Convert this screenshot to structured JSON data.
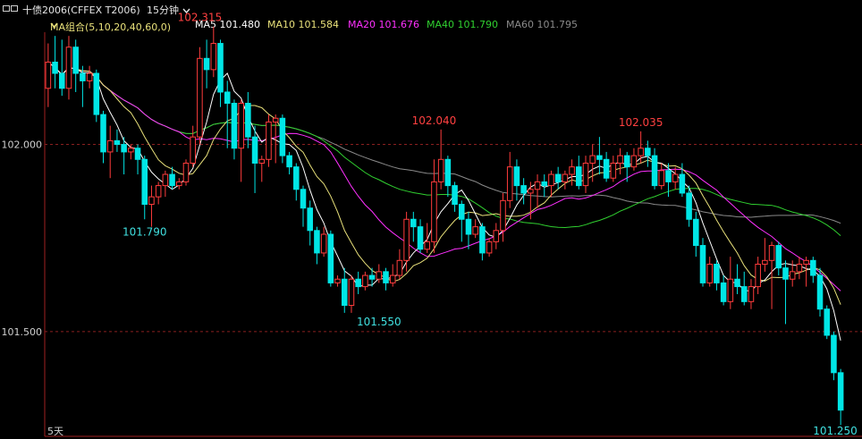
{
  "header": {
    "window_icon": "window-icon",
    "title": "十债2006(CFFEX T2006)",
    "period": "15分钟",
    "period_icon": "chevron-down-icon"
  },
  "indicators": {
    "group_label": "MA组合(5,10,20,40,60,0)",
    "group_icon": "chevron-down-icon",
    "items": [
      {
        "label": "MA5 101.480",
        "color": "#ffffff"
      },
      {
        "label": "MA10 101.584",
        "color": "#e8e07a"
      },
      {
        "label": "MA20 101.676",
        "color": "#ff30ff"
      },
      {
        "label": "MA40 101.790",
        "color": "#30d030"
      },
      {
        "label": "MA60 101.795",
        "color": "#8a8a8a"
      }
    ]
  },
  "footer": {
    "days_label": "5天"
  },
  "chart_data": {
    "type": "candlestick",
    "ylim": [
      101.22,
      102.3
    ],
    "y_ticks": [
      {
        "label": "102.000",
        "value": 102.0
      },
      {
        "label": "101.500",
        "value": 101.5
      }
    ],
    "annotations": [
      {
        "text": "102.315",
        "index": 22,
        "value": 102.315,
        "color": "#ff4040"
      },
      {
        "text": "101.790",
        "index": 14,
        "value": 101.79,
        "color": "#40e0e0"
      },
      {
        "text": "102.040",
        "index": 56,
        "value": 102.04,
        "color": "#ff4040"
      },
      {
        "text": "101.550",
        "index": 48,
        "value": 101.55,
        "color": "#40e0e0"
      },
      {
        "text": "102.035",
        "index": 86,
        "value": 102.035,
        "color": "#ff4040"
      },
      {
        "text": "101.250",
        "index": 115,
        "value": 101.25,
        "color": "#40e0e0"
      }
    ],
    "candles": [
      [
        102.15,
        102.22,
        102.27,
        102.1
      ],
      [
        102.22,
        102.19,
        102.29,
        102.15
      ],
      [
        102.19,
        102.15,
        102.28,
        102.13
      ],
      [
        102.15,
        102.26,
        102.29,
        102.12
      ],
      [
        102.26,
        102.19,
        102.28,
        102.14
      ],
      [
        102.19,
        102.17,
        102.21,
        102.1
      ],
      [
        102.17,
        102.19,
        102.21,
        102.15
      ],
      [
        102.19,
        102.08,
        102.2,
        102.06
      ],
      [
        102.08,
        101.98,
        102.09,
        101.95
      ],
      [
        101.98,
        102.01,
        102.05,
        101.91
      ],
      [
        102.01,
        102.0,
        102.04,
        101.98
      ],
      [
        102.0,
        101.98,
        102.02,
        101.92
      ],
      [
        101.98,
        101.99,
        102.0,
        101.96
      ],
      [
        101.99,
        101.96,
        102.0,
        101.92
      ],
      [
        101.96,
        101.84,
        101.97,
        101.8
      ],
      [
        101.84,
        101.86,
        101.89,
        101.78
      ],
      [
        101.86,
        101.89,
        101.9,
        101.84
      ],
      [
        101.89,
        101.92,
        101.93,
        101.86
      ],
      [
        101.92,
        101.89,
        101.94,
        101.88
      ],
      [
        101.89,
        101.9,
        101.91,
        101.88
      ],
      [
        101.9,
        101.95,
        101.96,
        101.89
      ],
      [
        101.95,
        102.02,
        102.05,
        101.94
      ],
      [
        102.02,
        102.23,
        102.26,
        102.0
      ],
      [
        102.23,
        102.2,
        102.28,
        102.15
      ],
      [
        102.2,
        102.27,
        102.315,
        102.18
      ],
      [
        102.27,
        102.14,
        102.28,
        102.1
      ],
      [
        102.14,
        102.11,
        102.17,
        101.99
      ],
      [
        102.11,
        101.99,
        102.12,
        101.96
      ],
      [
        101.99,
        102.11,
        102.12,
        101.9
      ],
      [
        102.11,
        102.02,
        102.14,
        101.99
      ],
      [
        102.02,
        101.95,
        102.05,
        101.87
      ],
      [
        101.95,
        101.96,
        101.97,
        101.9
      ],
      [
        101.96,
        102.06,
        102.08,
        101.94
      ],
      [
        102.06,
        102.07,
        102.08,
        101.95
      ],
      [
        102.07,
        101.97,
        102.08,
        101.95
      ],
      [
        101.97,
        101.94,
        101.98,
        101.92
      ],
      [
        101.94,
        101.88,
        101.95,
        101.85
      ],
      [
        101.88,
        101.83,
        101.89,
        101.78
      ],
      [
        101.83,
        101.77,
        101.85,
        101.73
      ],
      [
        101.77,
        101.71,
        101.78,
        101.68
      ],
      [
        101.71,
        101.76,
        101.78,
        101.7
      ],
      [
        101.76,
        101.63,
        101.77,
        101.62
      ],
      [
        101.63,
        101.64,
        101.65,
        101.62
      ],
      [
        101.64,
        101.57,
        101.67,
        101.55
      ],
      [
        101.57,
        101.64,
        101.65,
        101.55
      ],
      [
        101.64,
        101.62,
        101.66,
        101.6
      ],
      [
        101.62,
        101.65,
        101.66,
        101.61
      ],
      [
        101.65,
        101.64,
        101.67,
        101.62
      ],
      [
        101.64,
        101.66,
        101.68,
        101.63
      ],
      [
        101.66,
        101.63,
        101.67,
        101.61
      ],
      [
        101.63,
        101.65,
        101.68,
        101.62
      ],
      [
        101.65,
        101.69,
        101.72,
        101.64
      ],
      [
        101.69,
        101.8,
        101.82,
        101.66
      ],
      [
        101.8,
        101.78,
        101.82,
        101.74
      ],
      [
        101.78,
        101.72,
        101.8,
        101.71
      ],
      [
        101.72,
        101.74,
        101.79,
        101.71
      ],
      [
        101.74,
        101.9,
        101.96,
        101.71
      ],
      [
        101.9,
        101.96,
        102.04,
        101.88
      ],
      [
        101.96,
        101.89,
        101.97,
        101.86
      ],
      [
        101.89,
        101.84,
        101.9,
        101.82
      ],
      [
        101.84,
        101.8,
        101.85,
        101.74
      ],
      [
        101.8,
        101.76,
        101.82,
        101.72
      ],
      [
        101.76,
        101.78,
        101.8,
        101.75
      ],
      [
        101.78,
        101.71,
        101.79,
        101.69
      ],
      [
        101.71,
        101.74,
        101.75,
        101.7
      ],
      [
        101.74,
        101.77,
        101.79,
        101.72
      ],
      [
        101.77,
        101.85,
        101.87,
        101.74
      ],
      [
        101.85,
        101.94,
        101.98,
        101.83
      ],
      [
        101.94,
        101.89,
        101.96,
        101.85
      ],
      [
        101.89,
        101.87,
        101.91,
        101.84
      ],
      [
        101.87,
        101.88,
        101.9,
        101.8
      ],
      [
        101.88,
        101.9,
        101.92,
        101.83
      ],
      [
        101.9,
        101.89,
        101.92,
        101.86
      ],
      [
        101.89,
        101.92,
        101.93,
        101.86
      ],
      [
        101.92,
        101.9,
        101.94,
        101.88
      ],
      [
        101.9,
        101.92,
        101.93,
        101.88
      ],
      [
        101.92,
        101.94,
        101.96,
        101.89
      ],
      [
        101.94,
        101.89,
        101.97,
        101.88
      ],
      [
        101.89,
        101.95,
        101.97,
        101.87
      ],
      [
        101.95,
        101.97,
        102.0,
        101.9
      ],
      [
        101.97,
        101.96,
        102.02,
        101.92
      ],
      [
        101.96,
        101.91,
        101.98,
        101.9
      ],
      [
        101.91,
        101.95,
        101.97,
        101.9
      ],
      [
        101.95,
        101.97,
        101.99,
        101.92
      ],
      [
        101.97,
        101.94,
        101.98,
        101.9
      ],
      [
        101.94,
        101.97,
        101.99,
        101.93
      ],
      [
        101.97,
        101.99,
        102.035,
        101.95
      ],
      [
        101.99,
        101.97,
        102.01,
        101.94
      ],
      [
        101.97,
        101.89,
        101.99,
        101.88
      ],
      [
        101.89,
        101.93,
        101.95,
        101.88
      ],
      [
        101.93,
        101.9,
        101.95,
        101.86
      ],
      [
        101.9,
        101.92,
        101.94,
        101.88
      ],
      [
        101.92,
        101.87,
        101.95,
        101.86
      ],
      [
        101.87,
        101.8,
        101.89,
        101.78
      ],
      [
        101.8,
        101.73,
        101.82,
        101.7
      ],
      [
        101.73,
        101.63,
        101.75,
        101.62
      ],
      [
        101.63,
        101.68,
        101.7,
        101.62
      ],
      [
        101.68,
        101.63,
        101.69,
        101.61
      ],
      [
        101.63,
        101.58,
        101.65,
        101.57
      ],
      [
        101.58,
        101.64,
        101.7,
        101.56
      ],
      [
        101.64,
        101.62,
        101.68,
        101.6
      ],
      [
        101.62,
        101.58,
        101.66,
        101.57
      ],
      [
        101.58,
        101.62,
        101.64,
        101.56
      ],
      [
        101.62,
        101.68,
        101.7,
        101.6
      ],
      [
        101.68,
        101.69,
        101.75,
        101.66
      ],
      [
        101.69,
        101.73,
        101.74,
        101.56
      ],
      [
        101.73,
        101.67,
        101.74,
        101.65
      ],
      [
        101.67,
        101.64,
        101.69,
        101.52
      ],
      [
        101.64,
        101.66,
        101.69,
        101.62
      ],
      [
        101.66,
        101.68,
        101.7,
        101.64
      ],
      [
        101.68,
        101.69,
        101.7,
        101.62
      ],
      [
        101.69,
        101.65,
        101.7,
        101.63
      ],
      [
        101.65,
        101.56,
        101.67,
        101.54
      ],
      [
        101.56,
        101.49,
        101.57,
        101.48
      ],
      [
        101.49,
        101.39,
        101.5,
        101.37
      ],
      [
        101.39,
        101.29,
        101.4,
        101.25
      ]
    ]
  }
}
